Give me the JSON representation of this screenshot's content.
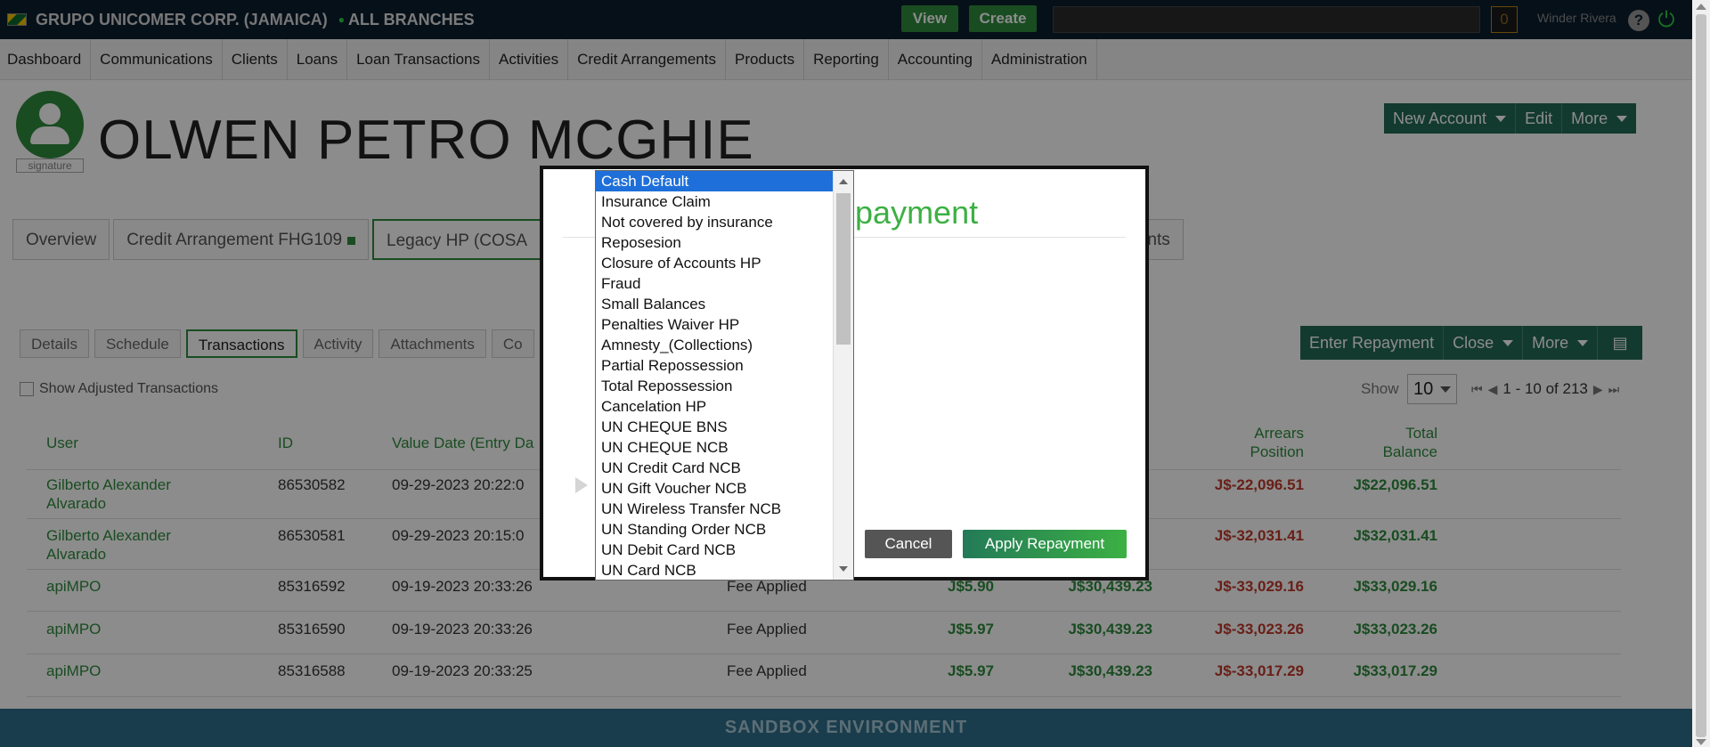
{
  "topbar": {
    "org_name": "GRUPO UNICOMER CORP. (JAMAICA)",
    "branch": "ALL BRANCHES",
    "view_label": "View",
    "create_label": "Create",
    "notification_count": "0",
    "user_name": "Winder Rivera",
    "help_label": "?"
  },
  "nav": {
    "items": [
      "Dashboard",
      "Communications",
      "Clients",
      "Loans",
      "Loan Transactions",
      "Activities",
      "Credit Arrangements",
      "Products",
      "Reporting",
      "Accounting",
      "Administration"
    ]
  },
  "client": {
    "name": "OLWEN PETRO MCGHIE",
    "signature_label": "signature"
  },
  "client_actions": {
    "new_account": "New Account",
    "edit": "Edit",
    "more": "More"
  },
  "account_tabs": {
    "overview": "Overview",
    "credit_arrangement": "Credit Arrangement FHG109",
    "legacy": "Legacy HP (COSA",
    "right_fragment": "ments"
  },
  "sub_tabs": [
    "Details",
    "Schedule",
    "Transactions",
    "Activity",
    "Attachments",
    "Co"
  ],
  "transactions_actions": {
    "enter_repayment": "Enter Repayment",
    "close": "Close",
    "more": "More"
  },
  "show_adjusted_label": "Show Adjusted Transactions",
  "pagination": {
    "show_label": "Show",
    "page_size": "10",
    "range": "1 - 10 of 213"
  },
  "table": {
    "headers": {
      "user": "User",
      "id": "ID",
      "value_date": "Value Date (Entry Da",
      "arrears_position": "Arrears Position",
      "total_balance": "Total Balance"
    },
    "rows": [
      {
        "user": "Gilberto Alexander Alvarado",
        "id": "86530582",
        "date": "09-29-2023 20:22:0",
        "type": "",
        "amount": "",
        "principal": "",
        "arrears": "J$-22,096.51",
        "balance": "J$22,096.51"
      },
      {
        "user": "Gilberto Alexander Alvarado",
        "id": "86530581",
        "date": "09-29-2023 20:15:0",
        "type": "",
        "amount": "",
        "principal": "",
        "arrears": "J$-32,031.41",
        "balance": "J$32,031.41"
      },
      {
        "user": "apiMPO",
        "id": "85316592",
        "date": "09-19-2023 20:33:26",
        "type": "Fee Applied",
        "amount": "J$5.90",
        "principal": "J$30,439.23",
        "arrears": "J$-33,029.16",
        "balance": "J$33,029.16"
      },
      {
        "user": "apiMPO",
        "id": "85316590",
        "date": "09-19-2023 20:33:26",
        "type": "Fee Applied",
        "amount": "J$5.97",
        "principal": "J$30,439.23",
        "arrears": "J$-33,023.26",
        "balance": "J$33,023.26"
      },
      {
        "user": "apiMPO",
        "id": "85316588",
        "date": "09-19-2023 20:33:25",
        "type": "Fee Applied",
        "amount": "J$5.97",
        "principal": "J$30,439.23",
        "arrears": "J$-33,017.29",
        "balance": "J$33,017.29"
      }
    ]
  },
  "footer": "SANDBOX ENVIRONMENT",
  "modal": {
    "title_fragment": "epayment",
    "cancel_label": "Cancel",
    "apply_label": "Apply Repayment"
  },
  "dropdown": {
    "selected": "Cash Default",
    "options": [
      "Cash Default",
      "Insurance Claim",
      "Not covered by insurance",
      "Reposesion",
      "Closure of Accounts HP",
      "Fraud",
      "Small Balances",
      "Penalties Waiver HP",
      "Amnesty_(Collections)",
      "Partial Repossession",
      "Total Repossession",
      "Cancelation HP",
      "UN CHEQUE BNS",
      "UN CHEQUE NCB",
      "UN Credit Card NCB",
      "UN Gift Voucher NCB",
      "UN Wireless Transfer NCB",
      "UN Standing Order NCB",
      "UN Debit Card NCB",
      "UN Card NCB"
    ]
  },
  "colors": {
    "brand_green": "#2e8b3d",
    "dark_teal": "#236b55",
    "topbar_bg": "#0c1e2e",
    "selected_option": "#1e6fd9",
    "negative_red": "#c0392b"
  }
}
